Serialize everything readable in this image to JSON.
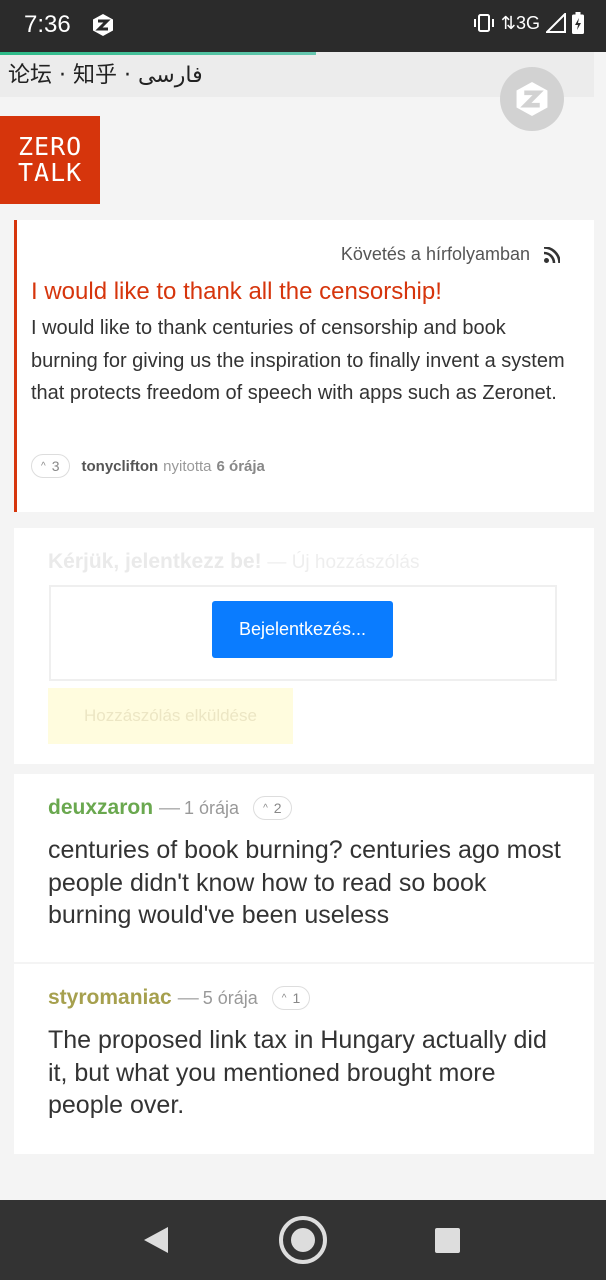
{
  "status": {
    "time": "7:36",
    "network": "3G"
  },
  "lang_bar": {
    "langs": "论坛 · 知乎 · فارسی"
  },
  "logo": {
    "line1": "ZERO",
    "line2": "TALK"
  },
  "post": {
    "follow_label": "Követés a hírfolyamban",
    "title": "I would like to thank all the censorship!",
    "body": "I would like to thank centuries of censorship and book burning for giving us the inspiration to finally invent a system that protects freedom of speech with apps such as Zeronet.",
    "votes": "3",
    "author": "tonyclifton",
    "verb": "nyitotta",
    "time": "6 órája"
  },
  "comment_form": {
    "heading": "Kérjük, jelentkezz be!",
    "sub": "— Új hozzászólás",
    "login_button": "Bejelentkezés...",
    "submit_button": "Hozzászólás elküldése"
  },
  "comments": [
    {
      "user": "deuxzaron",
      "user_color": "#6aa84f",
      "time": "1 órája",
      "votes": "2",
      "text": "centuries of book burning? centuries ago most people didn't know how to read so book burning would've been useless"
    },
    {
      "user": "styromaniac",
      "user_color": "#a6a04e",
      "time": "5 órája",
      "votes": "1",
      "text": "The proposed link tax in Hungary actually did it, but what you mentioned brought more people over."
    }
  ],
  "colors": {
    "accent": "#d6350c",
    "button_blue": "#0a7cff"
  }
}
